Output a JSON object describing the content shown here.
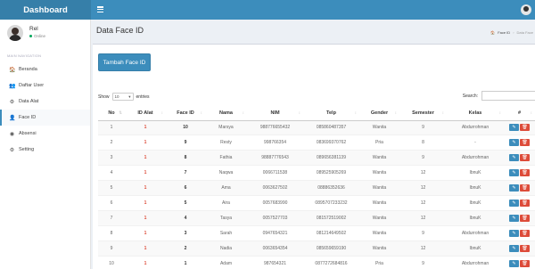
{
  "brand": "Dashboard",
  "user": {
    "name": "Rel",
    "status": "Online"
  },
  "nav_header": "MAIN NAVIGATION",
  "menu": [
    {
      "icon": "🏠",
      "icon_name": "home-icon",
      "label": "Beranda"
    },
    {
      "icon": "👥",
      "icon_name": "users-icon",
      "label": "Daftar User"
    },
    {
      "icon": "⚙",
      "icon_name": "cogs-icon",
      "label": "Data Alat"
    },
    {
      "icon": "👤",
      "icon_name": "user-icon",
      "label": "Face ID",
      "active": true
    },
    {
      "icon": "◉",
      "icon_name": "absensi-icon",
      "label": "Absensi"
    },
    {
      "icon": "⚙",
      "icon_name": "gear-icon",
      "label": "Setting"
    }
  ],
  "page_title": "Data Face ID",
  "breadcrumb": {
    "item": "Face ID",
    "current": "Data Face"
  },
  "add_button": "Tambah Face ID",
  "length_control": {
    "show": "Show",
    "value": "10",
    "entries": "entries"
  },
  "search_label": "Search:",
  "table": {
    "columns": [
      "No",
      "ID Alat",
      "Face ID",
      "Nama",
      "NIM",
      "Telp",
      "Gender",
      "Semester",
      "Kelas",
      "#"
    ],
    "rows": [
      [
        "1",
        "1",
        "10",
        "Marsya",
        "988776655432",
        "085860487357",
        "Wanita",
        "9",
        "Abdurrohman"
      ],
      [
        "2",
        "1",
        "9",
        "Resty",
        "998766354",
        "083699370762",
        "Pria",
        "8",
        "-"
      ],
      [
        "3",
        "1",
        "8",
        "Fathia",
        "98887776543",
        "089656381139",
        "Wanita",
        "9",
        "Abdurrohman"
      ],
      [
        "4",
        "1",
        "7",
        "Naqwa",
        "0066711538",
        "089525905269",
        "Wanita",
        "12",
        "IbnuK"
      ],
      [
        "5",
        "1",
        "6",
        "Ama",
        "0063627502",
        "08886352636",
        "Wanita",
        "12",
        "IbnuK"
      ],
      [
        "6",
        "1",
        "5",
        "Aira",
        "0057683990",
        "0895707233232",
        "Wanita",
        "12",
        "IbnuK"
      ],
      [
        "7",
        "1",
        "4",
        "Tasya",
        "0057527703",
        "081572519002",
        "Wanita",
        "12",
        "IbnuK"
      ],
      [
        "8",
        "1",
        "3",
        "Sarah",
        "0947654321",
        "081214649502",
        "Wanita",
        "9",
        "Abdurrohman"
      ],
      [
        "9",
        "1",
        "2",
        "Nadia",
        "0063654354",
        "085659659190",
        "Wanita",
        "12",
        "IbnuK"
      ],
      [
        "10",
        "1",
        "1",
        "Adam",
        "987654321",
        "0877272684816",
        "Pria",
        "9",
        "Abdurrohman"
      ]
    ]
  },
  "colors": {
    "brand_bg": "#367fa9",
    "navbar_bg": "#3c8dbc",
    "edit_button": "#3c8dbc",
    "delete_button": "#dd4b39",
    "status_online": "#00a65a"
  }
}
